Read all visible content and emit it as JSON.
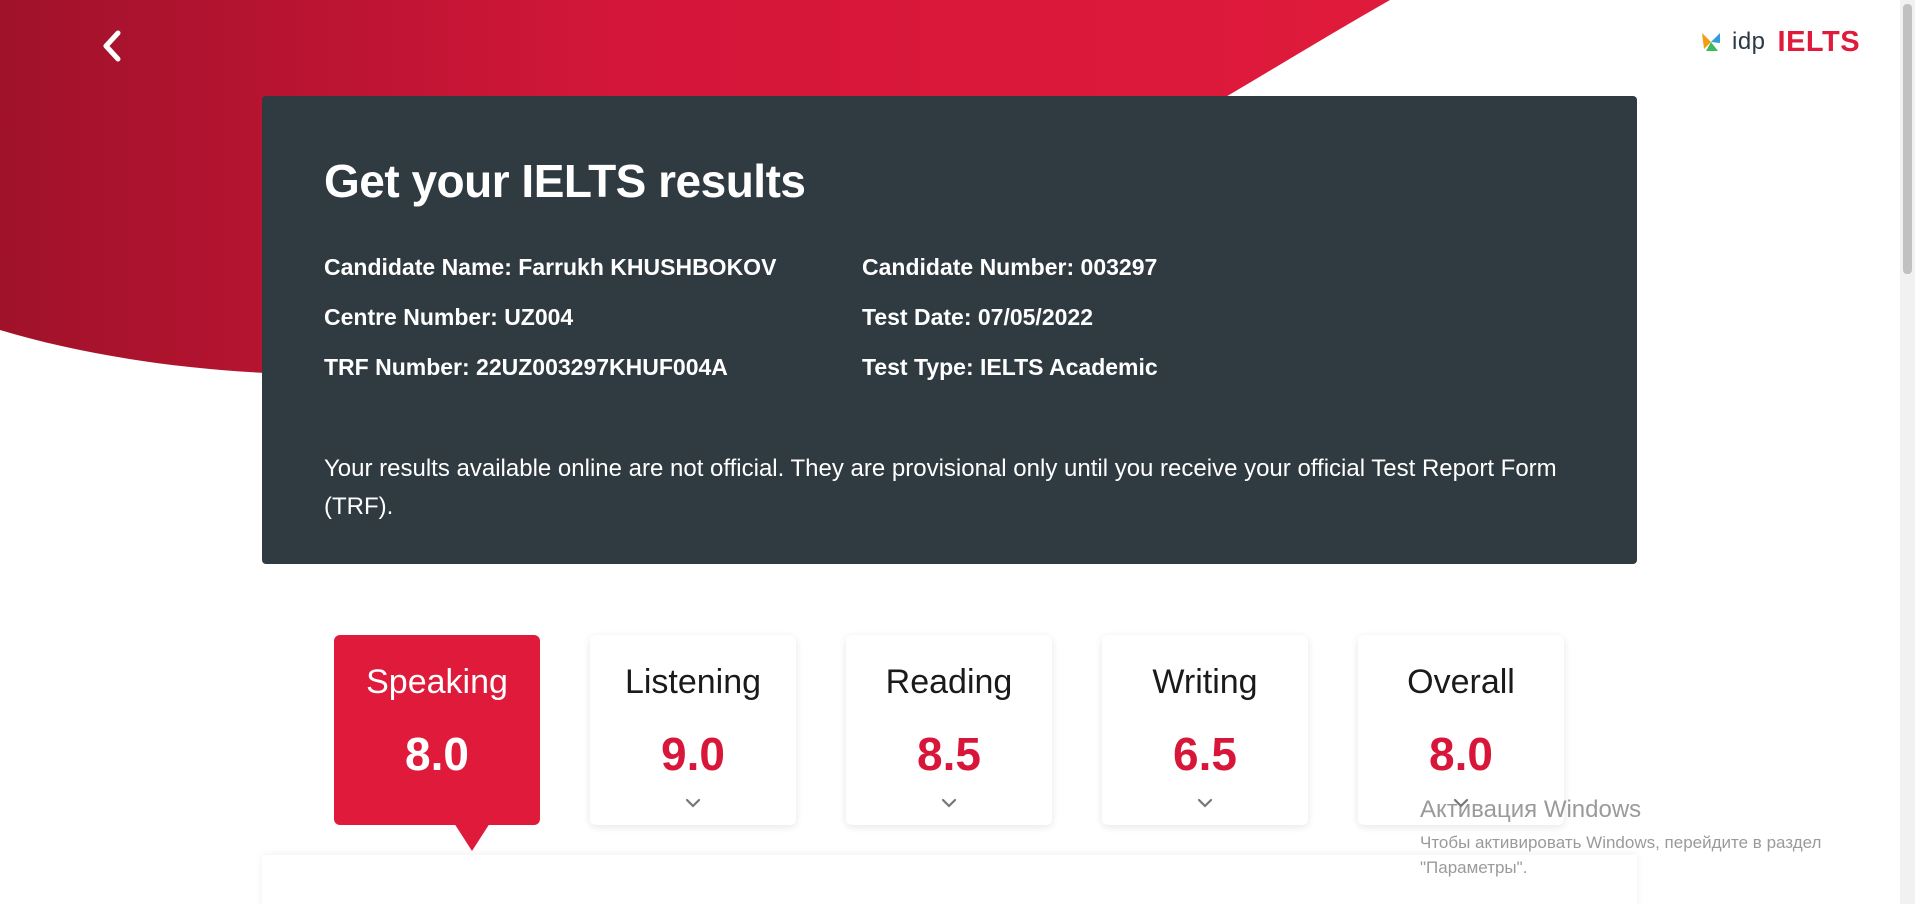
{
  "colors": {
    "brand_red": "#e01a3b",
    "brand_red_dark": "#a0122a",
    "card_bg": "#2f3a41",
    "score_red": "#d8163a"
  },
  "nav": {
    "back_icon": "chevron-left-icon"
  },
  "brand": {
    "idp_label": "idp",
    "ielts_label": "IELTS"
  },
  "info_card": {
    "title": "Get your IELTS results",
    "fields": {
      "candidate_name": "Candidate Name: Farrukh KHUSHBOKOV",
      "centre_number": "Centre Number: UZ004",
      "trf_number": "TRF Number: 22UZ003297KHUF004A",
      "candidate_number": "Candidate Number: 003297",
      "test_date": "Test Date: 07/05/2022",
      "test_type": "Test Type: IELTS Academic"
    },
    "note": "Your results available online are not official. They are provisional only until you receive your official Test Report Form (TRF)."
  },
  "scores": [
    {
      "label": "Speaking",
      "score": "8.0",
      "selected": true
    },
    {
      "label": "Listening",
      "score": "9.0",
      "selected": false
    },
    {
      "label": "Reading",
      "score": "8.5",
      "selected": false
    },
    {
      "label": "Writing",
      "score": "6.5",
      "selected": false
    },
    {
      "label": "Overall",
      "score": "8.0",
      "selected": false
    }
  ],
  "watermark": {
    "title": "Активация Windows",
    "line1": "Чтобы активировать Windows, перейдите в раздел",
    "line2": "\"Параметры\"."
  }
}
